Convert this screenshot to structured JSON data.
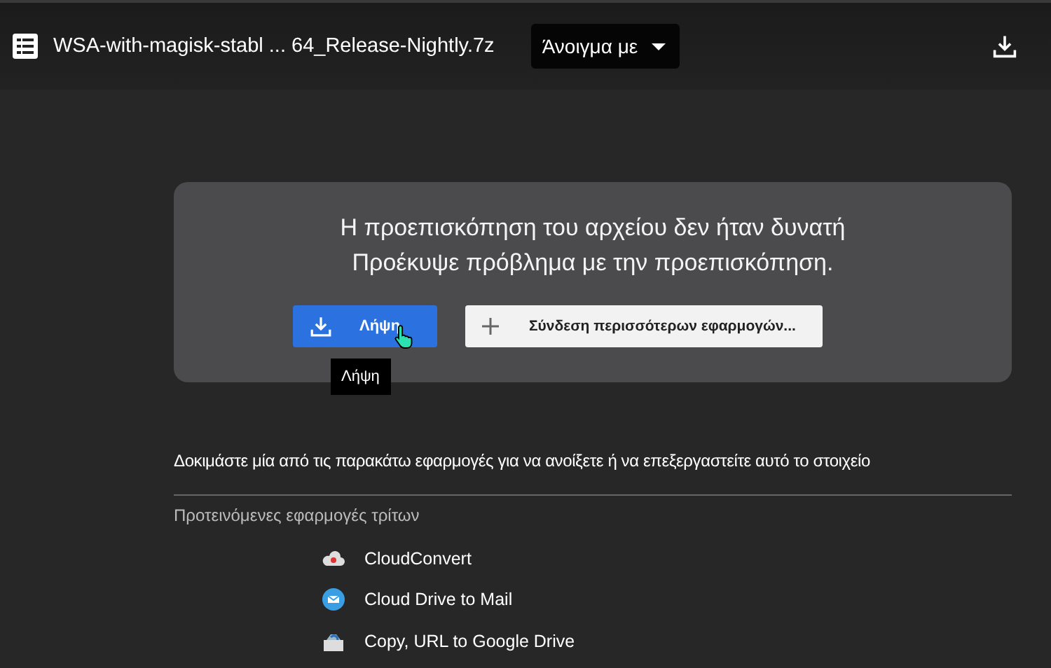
{
  "top_bar": {
    "file_name": "WSA-with-magisk-stabl ... 64_Release-Nightly.7z",
    "open_with": "Άνοιγμα με"
  },
  "preview_card": {
    "title_lines": [
      "Η προεπισκόπηση του αρχείου δεν ήταν δυνατή",
      "Προέκυψε πρόβλημα με την προεπισκόπηση."
    ],
    "download_button": "Λήψη",
    "connect_button": "Σύνδεση περισσότερων εφαρμογών...",
    "tooltip": "Λήψη"
  },
  "suggestions": {
    "intro": "Δοκιμάστε μία από τις παρακάτω εφαρμογές για να ανοίξετε ή να επεξεργαστείτε αυτό το στοιχείο",
    "heading": "Προτεινόμενες εφαρμογές τρίτων",
    "apps": [
      {
        "name": "CloudConvert",
        "kind": "cloud"
      },
      {
        "name": "Cloud Drive to Mail",
        "kind": "mail"
      },
      {
        "name": "Copy, URL to Google Drive",
        "kind": "drive"
      }
    ]
  }
}
